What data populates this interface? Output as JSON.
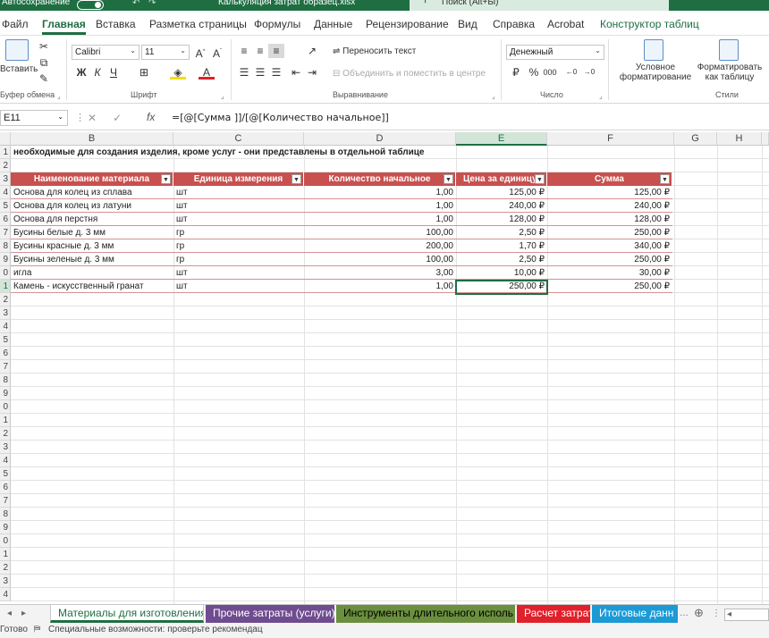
{
  "title_bar": {
    "autosave_label": "Автосохранение",
    "file_name": "Калькуляция затрат образец.xlsx",
    "search_placeholder": "Поиск (Alt+Ы)"
  },
  "menu_tabs": [
    "Файл",
    "Главная",
    "Вставка",
    "Разметка страницы",
    "Формулы",
    "Данные",
    "Рецензирование",
    "Вид",
    "Справка",
    "Acrobat",
    "Конструктор таблиц"
  ],
  "ribbon": {
    "clipboard": {
      "paste_label": "Вставить",
      "group_label": "Буфер обмена"
    },
    "font": {
      "font_name": "Calibri",
      "font_size": "11",
      "group_label": "Шрифт",
      "bold": "Ж",
      "italic": "К",
      "underline": "Ч"
    },
    "alignment": {
      "wrap_text": "Переносить текст",
      "merge_center": "Объединить и поместить в центре",
      "group_label": "Выравнивание"
    },
    "number": {
      "format": "Денежный",
      "group_label": "Число"
    },
    "styles": {
      "conditional": "Условное форматирование",
      "format_as_table": "Форматировать как таблицу",
      "group_label": "Стили"
    }
  },
  "formula_bar": {
    "name_box": "E11",
    "fx_label": "fx",
    "formula": "=[@[Сумма ]]/[@[Количество начальное]]"
  },
  "columns": [
    "B",
    "C",
    "D",
    "E",
    "F",
    "G",
    "H"
  ],
  "row_numbers": [
    "1",
    "2",
    "3",
    "4",
    "5",
    "6",
    "7",
    "8",
    "9",
    "0",
    "1",
    "2",
    "3",
    "4",
    "5",
    "6",
    "7",
    "8",
    "9",
    "0",
    "1",
    "2",
    "3",
    "4",
    "5",
    "6",
    "7",
    "8",
    "9",
    "0",
    "1",
    "2",
    "3",
    "4"
  ],
  "sheet": {
    "note": "необходимые для создания изделия, кроме услуг - они представлены в отдельной таблице",
    "table_headers": [
      "Наименование материала",
      "Единица измерения",
      "Количество начальное",
      "Цена за единицу",
      "Сумма"
    ],
    "rows": [
      [
        "Основа для колец из сплава",
        "шт",
        "1,00",
        "125,00 ₽",
        "125,00 ₽"
      ],
      [
        "Основа для колец из латуни",
        "шт",
        "1,00",
        "240,00 ₽",
        "240,00 ₽"
      ],
      [
        "Основа для перстня",
        "шт",
        "1,00",
        "128,00 ₽",
        "128,00 ₽"
      ],
      [
        "Бусины белые д. 3 мм",
        "гр",
        "100,00",
        "2,50 ₽",
        "250,00 ₽"
      ],
      [
        "Бусины красные д. 3 мм",
        "гр",
        "200,00",
        "1,70 ₽",
        "340,00 ₽"
      ],
      [
        "Бусины зеленые д. 3 мм",
        "гр",
        "100,00",
        "2,50 ₽",
        "250,00 ₽"
      ],
      [
        "игла",
        "шт",
        "3,00",
        "10,00 ₽",
        "30,00 ₽"
      ],
      [
        "Камень - искусственный гранат",
        "шт",
        "1,00",
        "250,00 ₽",
        "250,00 ₽"
      ]
    ]
  },
  "sheet_tabs": [
    {
      "label": "Материалы для изготовления",
      "color": "#1e6e42",
      "active": true
    },
    {
      "label": "Прочие затраты (услуги)",
      "color": "#6f4c8f",
      "active": false
    },
    {
      "label": "Инструменты длительного исполь",
      "color": "#6a8f3e",
      "active": false
    },
    {
      "label": "Расчет затрат",
      "color": "#e0202a",
      "active": false
    },
    {
      "label": "Итоговые данн",
      "color": "#1b9ad6",
      "active": false
    }
  ],
  "status_bar": {
    "ready": "Готово",
    "accessibility": "Специальные возможности: проверьте рекомендац"
  }
}
